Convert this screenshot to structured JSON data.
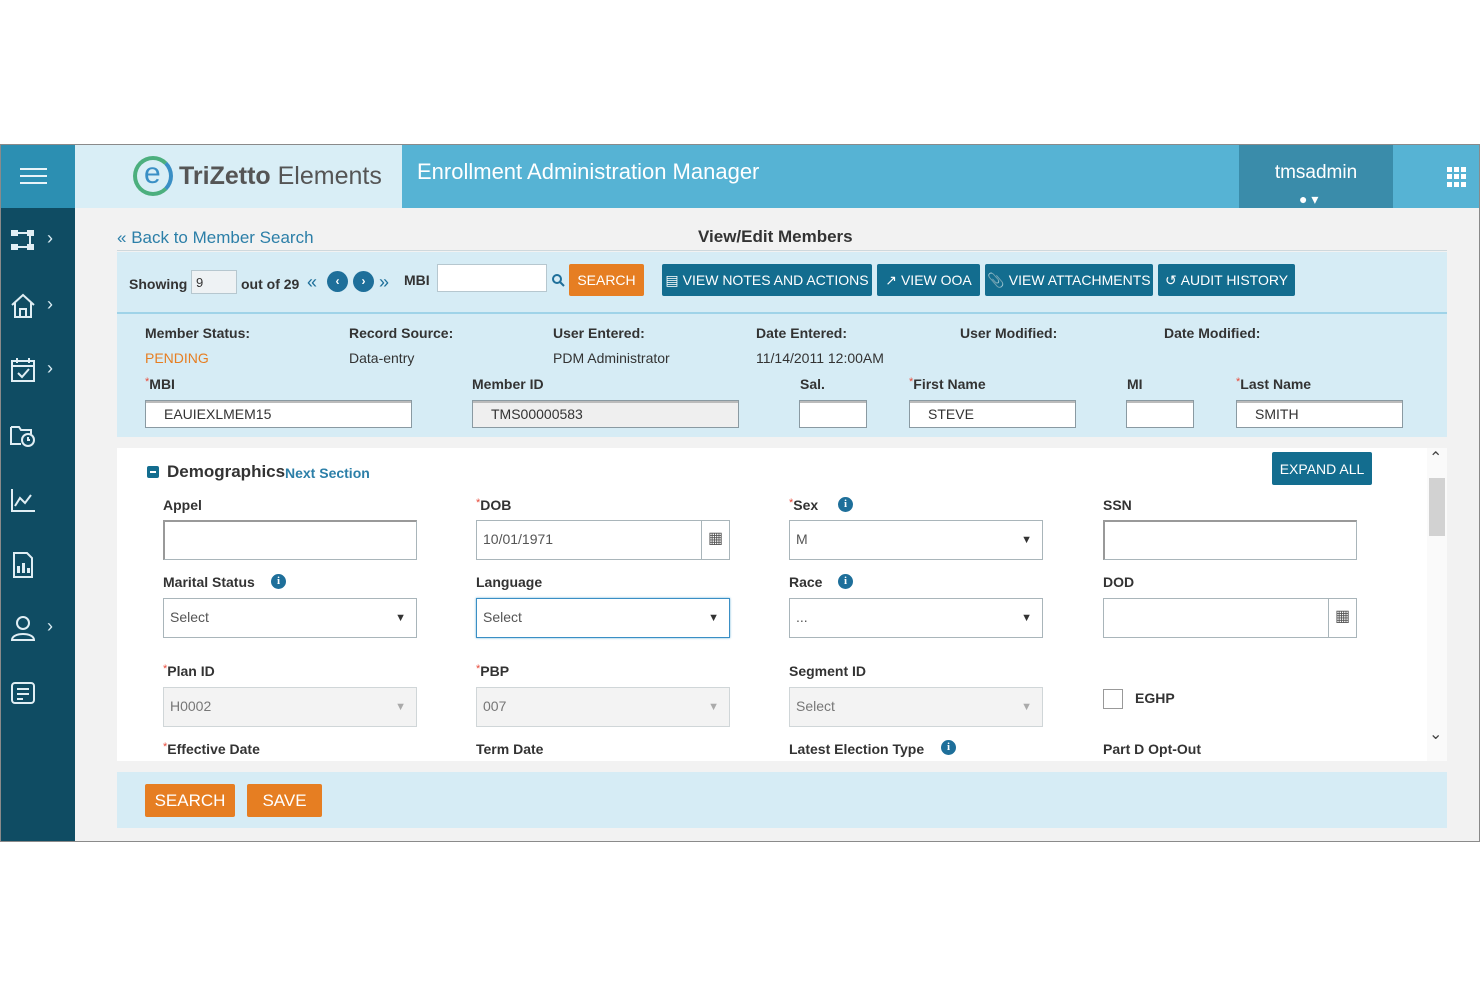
{
  "app": {
    "logo_text_bold": "TriZetto",
    "logo_text_rest": " Elements",
    "title": "Enrollment Administration Manager",
    "username": "tmsadmin"
  },
  "nav": {
    "back_link": "Back to Member Search",
    "page_title": "View/Edit Members"
  },
  "toolbar": {
    "showing_label": "Showing",
    "showing_value": "9",
    "out_of": "out of 29",
    "mbi_label": "MBI",
    "mbi_value": "",
    "search_label": "SEARCH",
    "view_notes": "VIEW NOTES AND ACTIONS",
    "view_ooa": "VIEW OOA",
    "view_attachments": "VIEW ATTACHMENTS",
    "audit_history": "AUDIT HISTORY"
  },
  "member_info": {
    "member_status_label": "Member Status:",
    "member_status_value": "PENDING",
    "record_source_label": "Record Source:",
    "record_source_value": "Data-entry",
    "user_entered_label": "User Entered:",
    "user_entered_value": "PDM Administrator",
    "date_entered_label": "Date Entered:",
    "date_entered_value": "11/14/2011 12:00AM",
    "user_modified_label": "User Modified:",
    "date_modified_label": "Date Modified:",
    "mbi_label": "MBI",
    "mbi_value": "EAUIEXLMEM15",
    "member_id_label": "Member ID",
    "member_id_value": "TMS00000583",
    "sal_label": "Sal.",
    "sal_value": "",
    "first_name_label": "First Name",
    "first_name_value": "STEVE",
    "mi_label": "MI",
    "mi_value": "",
    "last_name_label": "Last Name",
    "last_name_value": "SMITH"
  },
  "demographics": {
    "title": "Demographics",
    "next_section": "Next Section",
    "expand_all": "EXPAND ALL",
    "appel_label": "Appel",
    "appel_value": "",
    "dob_label": "DOB",
    "dob_value": "10/01/1971",
    "sex_label": "Sex",
    "sex_value": "M",
    "ssn_label": "SSN",
    "ssn_value": "",
    "marital_label": "Marital Status",
    "marital_value": "Select",
    "language_label": "Language",
    "language_value": "Select",
    "race_label": "Race",
    "race_value": "...",
    "dod_label": "DOD",
    "dod_value": "",
    "plan_id_label": "Plan ID",
    "plan_id_value": "H0002",
    "pbp_label": "PBP",
    "pbp_value": "007",
    "segment_label": "Segment ID",
    "segment_value": "Select",
    "eghp_label": "EGHP",
    "effective_date_label": "Effective Date",
    "term_date_label": "Term Date",
    "latest_election_label": "Latest Election Type",
    "partd_label": "Part D Opt-Out"
  },
  "footer": {
    "search": "SEARCH",
    "save": "SAVE"
  },
  "colors": {
    "topbar": "#56b3d4",
    "sidebar": "#0f4c63",
    "accent_orange": "#e67e22",
    "button_blue": "#136d8f",
    "panel": "#d6ecf5"
  }
}
